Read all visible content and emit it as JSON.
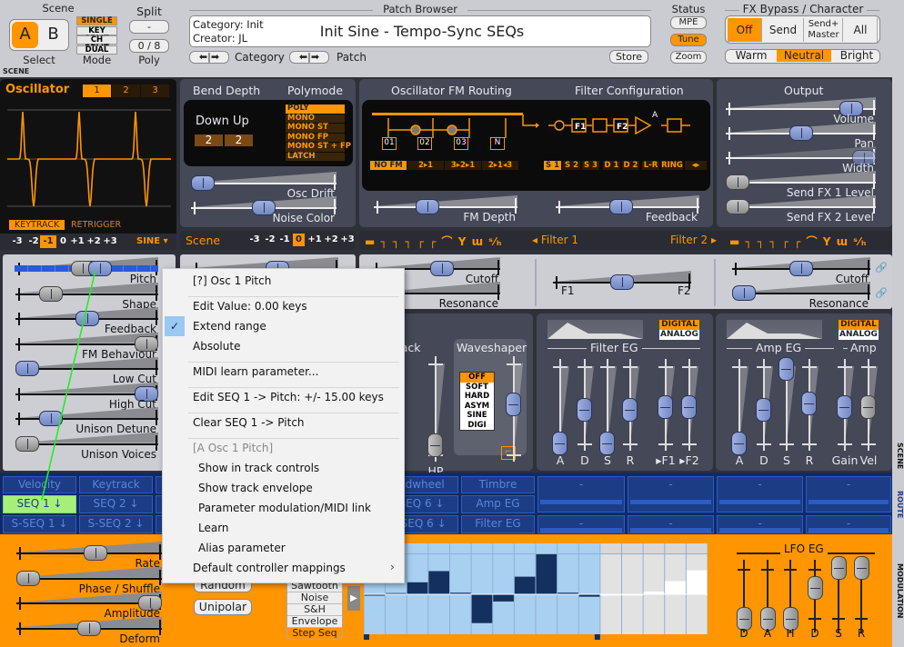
{
  "top": {
    "scene_title": "Scene",
    "scene_a": "A",
    "scene_b": "B",
    "select_label": "Select",
    "modes": [
      "SINGLE",
      "KEY SPLIT",
      "CH SPLIT",
      "DUAL"
    ],
    "mode_label": "Mode",
    "mode_selected": "SINGLE",
    "split_title": "Split",
    "split_value": "-",
    "poly_value": "0 / 8",
    "poly_label": "Poly",
    "browser_title": "Patch Browser",
    "category": "Category: Init",
    "creator": "Creator: JL",
    "patch_name": "Init Sine - Tempo-Sync SEQs",
    "category_nav": "Category",
    "patch_nav": "Patch",
    "store": "Store",
    "status_title": "Status",
    "mpe": "MPE",
    "tune": "Tune",
    "zoom": "Zoom",
    "fx_title": "FX Bypass / Character",
    "fx_bypass": [
      "Off",
      "Send",
      "Send+ Master",
      "All"
    ],
    "fx_selected": "Off",
    "character": [
      "Warm",
      "Neutral",
      "Bright"
    ],
    "character_selected": "Neutral",
    "scene_strip": "SCENE"
  },
  "osc": {
    "title": "Oscillator",
    "tabs": [
      "1",
      "2",
      "3"
    ],
    "active_tab": "1",
    "keytrack": "KEYTRACK",
    "retrigger": "RETRIGGER",
    "octaves": [
      "-3",
      "-2",
      "-1",
      "0",
      "+1",
      "+2",
      "+3"
    ],
    "octave_selected": "-1",
    "type": "SINE"
  },
  "bend": {
    "title": "Bend Depth",
    "down_up": "Down Up",
    "down": "2",
    "up": "2"
  },
  "polymode": {
    "title": "Polymode",
    "options": [
      "POLY",
      "MONO",
      "MONO ST",
      "MONO FP",
      "MONO ST + FP",
      "LATCH"
    ],
    "selected": "POLY"
  },
  "scene_sliders": [
    {
      "label": "Osc Drift",
      "value": 0
    },
    {
      "label": "Noise Color",
      "value": 0.5
    }
  ],
  "fm": {
    "title": "Oscillator FM Routing",
    "nodes": [
      "01",
      "02",
      "03",
      "N"
    ],
    "options": [
      "NO FM",
      "2▸1",
      "3▸2▸1",
      "2▸1◂3"
    ],
    "selected": "NO FM",
    "depth_label": "FM Depth",
    "depth": 0.35
  },
  "filter_config": {
    "title": "Filter Configuration",
    "blocks": [
      "F1",
      "F2"
    ],
    "amp_label": "A",
    "options": [
      "S 1",
      "S 2",
      "S 3",
      "D 1",
      "D 2",
      "L-R",
      "RING",
      "◂▸"
    ],
    "selected": "S 1",
    "feedback_label": "Feedback",
    "feedback": 0.45
  },
  "output": {
    "title": "Output",
    "sliders": [
      {
        "label": "Volume",
        "value": 0.9
      },
      {
        "label": "Pan",
        "value": 0.5
      },
      {
        "label": "Width",
        "value": 1.0
      },
      {
        "label": "Send FX 1 Level",
        "value": 0
      },
      {
        "label": "Send FX 2 Level",
        "value": 0
      }
    ]
  },
  "scene_pitch": {
    "title": "Scene",
    "octaves": [
      "-3",
      "-2",
      "-1",
      "0",
      "+1",
      "+2",
      "+3"
    ],
    "selected": "0"
  },
  "filter_bar": {
    "filter1": "◂ Filter 1",
    "filter2": "Filter 2 ▸"
  },
  "osc_params": [
    {
      "label": "Pitch",
      "value": 0.5
    },
    {
      "label": "Shape",
      "value": 0.2
    },
    {
      "label": "Feedback",
      "value": 0.5
    },
    {
      "label": "FM Behaviour",
      "value": 1.0
    },
    {
      "label": "Low Cut",
      "value": 0
    },
    {
      "label": "High Cut",
      "value": 1.0
    },
    {
      "label": "Unison Detune",
      "value": 0.2
    },
    {
      "label": "Unison Voices",
      "value": 0
    }
  ],
  "filters": {
    "f1_cutoff_label": "Cutoff",
    "f1_cutoff": 0.55,
    "f1_res_label": "Resonance",
    "balance_left": "F1",
    "balance_right": "F2",
    "balance": 0.5,
    "f2_cutoff_label": "Cutoff",
    "f2_cutoff": 0.5,
    "f2_res_label": "Resonance",
    "f2_res": 0
  },
  "mixer": {
    "feedback_label": "Feedback",
    "hp_label": "HP",
    "hp": 0.1
  },
  "waveshaper": {
    "title": "Waveshaper",
    "options": [
      "OFF",
      "SOFT",
      "HARD",
      "ASYM",
      "SINE",
      "DIGI"
    ],
    "selected": "OFF",
    "drive": 0.55
  },
  "filter_eg": {
    "title": "Filter EG",
    "modes": [
      "DIGITAL",
      "ANALOG"
    ],
    "selected": "DIGITAL",
    "sliders": [
      {
        "label": "A",
        "value": 0
      },
      {
        "label": "D",
        "value": 0.44
      },
      {
        "label": "S",
        "value": 0
      },
      {
        "label": "R",
        "value": 0.44
      },
      {
        "label": "▸F1",
        "value": 0.47
      },
      {
        "label": "▸F2",
        "value": 0.47
      }
    ]
  },
  "amp_eg": {
    "title": "Amp EG",
    "amp_title": "Amp",
    "modes": [
      "DIGITAL",
      "ANALOG"
    ],
    "selected": "DIGITAL",
    "sliders": [
      {
        "label": "A",
        "value": 0
      },
      {
        "label": "D",
        "value": 0.44
      },
      {
        "label": "S",
        "value": 0.97
      },
      {
        "label": "R",
        "value": 0.52
      },
      {
        "label": "Gain",
        "value": 0.47
      },
      {
        "label": "Vel",
        "value": 0.47
      }
    ]
  },
  "route": {
    "row1": [
      "Velocity",
      "Keytrack",
      "",
      "",
      "",
      "odwheel",
      "Timbre",
      "-",
      "-",
      "-",
      "-"
    ],
    "row2": [
      "SEQ 1 ↓",
      "SEQ 2 ↓",
      "",
      "",
      "",
      "SEQ 6 ↓",
      "Amp EG",
      "-",
      "-",
      "-",
      "-"
    ],
    "row3": [
      "S-SEQ 1 ↓",
      "S-SEQ 2 ↓",
      "",
      "",
      "",
      "-SEQ 6 ↓",
      "Filter EG",
      "-",
      "-",
      "-",
      "-"
    ],
    "selected": "SEQ 1 ↓",
    "strip": "ROUTE"
  },
  "modulation": {
    "sliders": [
      {
        "label": "Rate",
        "value": 0.55
      },
      {
        "label": "Phase / Shuffle",
        "value": 0
      },
      {
        "label": "Amplitude",
        "value": 1.0
      },
      {
        "label": "Deform",
        "value": 0.5
      }
    ],
    "random": "Random",
    "unipolar": "Unipolar",
    "shapes": [
      "Sawtooth",
      "Noise",
      "S&H",
      "Envelope",
      "Step Seq"
    ],
    "shape_selected": "Step Seq",
    "steps": [
      0,
      0.03,
      0.3,
      0.58,
      0.04,
      -0.72,
      -0.18,
      0.44,
      1.0,
      0.04,
      -0.06,
      0,
      0,
      0.07,
      0.33,
      0.6
    ],
    "active_steps": 11,
    "lfo_eg_title": "LFO EG",
    "lfo_eg": [
      {
        "label": "D",
        "value": 0
      },
      {
        "label": "A",
        "value": 0
      },
      {
        "label": "H",
        "value": 0
      },
      {
        "label": "D",
        "value": 0.6
      },
      {
        "label": "S",
        "value": 1.0
      },
      {
        "label": "R",
        "value": 1.0
      }
    ],
    "strip": "MODULATION"
  },
  "menu": {
    "items": [
      {
        "label": "[?] Osc 1 Pitch"
      },
      {
        "sep": true
      },
      {
        "label": "Edit Value: 0.00 keys"
      },
      {
        "label": "Extend range",
        "checked": true
      },
      {
        "label": "Absolute"
      },
      {
        "sep": true
      },
      {
        "label": "MIDI learn parameter..."
      },
      {
        "sep": true
      },
      {
        "label": "Edit SEQ 1 -> Pitch: +/- 15.00 keys"
      },
      {
        "sep": true
      },
      {
        "label": "Clear SEQ 1 -> Pitch"
      },
      {
        "sep": true
      },
      {
        "label": "[A Osc 1 Pitch]",
        "disabled": true
      },
      {
        "label": "Show in track controls",
        "indent": true
      },
      {
        "label": "Show track envelope",
        "indent": true
      },
      {
        "label": "Parameter modulation/MIDI link",
        "indent": true
      },
      {
        "label": "Learn",
        "indent": true
      },
      {
        "label": "Alias parameter",
        "indent": true
      },
      {
        "label": "Default controller mappings",
        "submenu": true
      }
    ]
  },
  "colors": {
    "accent": "#ff9500",
    "route_bg": "#1b3d86",
    "mod_bg": "#ff9500",
    "seq_active": "#a8d0f0",
    "seq_bar": "#14305e",
    "drag_line": "#22ee22"
  }
}
